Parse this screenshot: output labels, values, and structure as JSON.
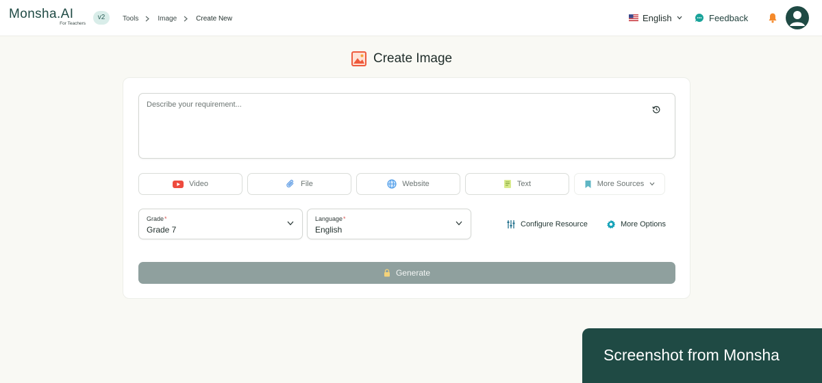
{
  "header": {
    "logo_name": "Monsha.AI",
    "logo_subtitle": "For Teachers",
    "version": "v2",
    "breadcrumb": [
      "Tools",
      "Image",
      "Create New"
    ],
    "language": "English",
    "feedback": "Feedback"
  },
  "page": {
    "title": "Create Image"
  },
  "form": {
    "prompt_placeholder": "Describe your requirement...",
    "prompt_value": "",
    "sources": [
      "Video",
      "File",
      "Website",
      "Text",
      "More Sources"
    ],
    "grade": {
      "label": "Grade",
      "required_mark": "*",
      "value": "Grade 7"
    },
    "language": {
      "label": "Language",
      "required_mark": "*",
      "value": "English"
    },
    "configure_resource": "Configure Resource",
    "more_options": "More Options",
    "generate": "Generate"
  },
  "banner": {
    "text": "Screenshot from Monsha"
  },
  "colors": {
    "brand_dark": "#1f4a44",
    "badge_bg": "#d9ede9",
    "generate_disabled": "#8fa09e",
    "page_bg": "#f9f9f4",
    "video_red": "#ee4b3e",
    "bell_orange": "#f58a2b",
    "feedback_teal": "#1aa39a"
  }
}
